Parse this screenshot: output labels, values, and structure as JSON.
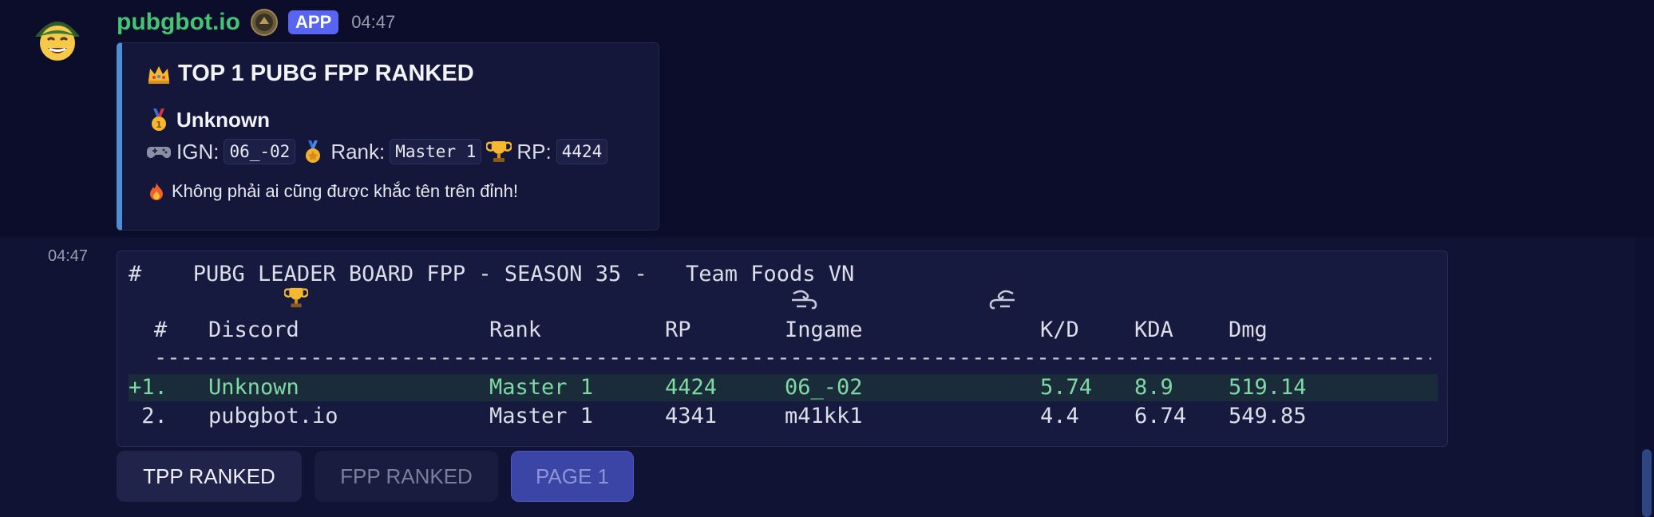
{
  "message1": {
    "username": "pubgbot.io",
    "app_tag": "APP",
    "timestamp": "04:47",
    "embed": {
      "title": "TOP 1 PUBG FPP RANKED",
      "player_name": "Unknown",
      "ign_label": "IGN:",
      "ign_value": "06_-02",
      "rank_label": "Rank:",
      "rank_value": "Master 1",
      "rp_label": "RP:",
      "rp_value": "4424",
      "footer": "Không phải ai cũng được khắc tên trên đỉnh!",
      "accent_color": "#4d8fd6"
    }
  },
  "message2": {
    "timestamp": "04:47",
    "leaderboard": {
      "title_prefix": "# ",
      "title_main": " PUBG LEADER BOARD FPP - SEASON 35 - ",
      "title_team": "Team Foods VN",
      "headers": {
        "num": "#",
        "discord": "Discord",
        "rank": "Rank",
        "rp": "RP",
        "ingame": "Ingame",
        "kd": "K/D",
        "kda": "KDA",
        "dmg": "Dmg"
      },
      "separator": "-----------------------------------------------------------------------------------------------------",
      "rows": [
        {
          "num": "+1.",
          "discord": "Unknown",
          "rank": "Master 1",
          "rp": "4424",
          "ingame": "06_-02",
          "kd": "5.74",
          "kda": "8.9",
          "dmg": "519.14"
        },
        {
          "num": " 2.",
          "discord": "pubgbot.io",
          "rank": "Master 1",
          "rp": "4341",
          "ingame": "m41kk1",
          "kd": "4.4",
          "kda": "6.74",
          "dmg": "549.85"
        }
      ]
    },
    "buttons": {
      "tpp": "TPP RANKED",
      "fpp": "FPP RANKED",
      "page": "PAGE 1"
    }
  },
  "colors": {
    "username": "#43c572",
    "app_tag": "#5865f2",
    "highlight_row": "#7fd9a4"
  }
}
